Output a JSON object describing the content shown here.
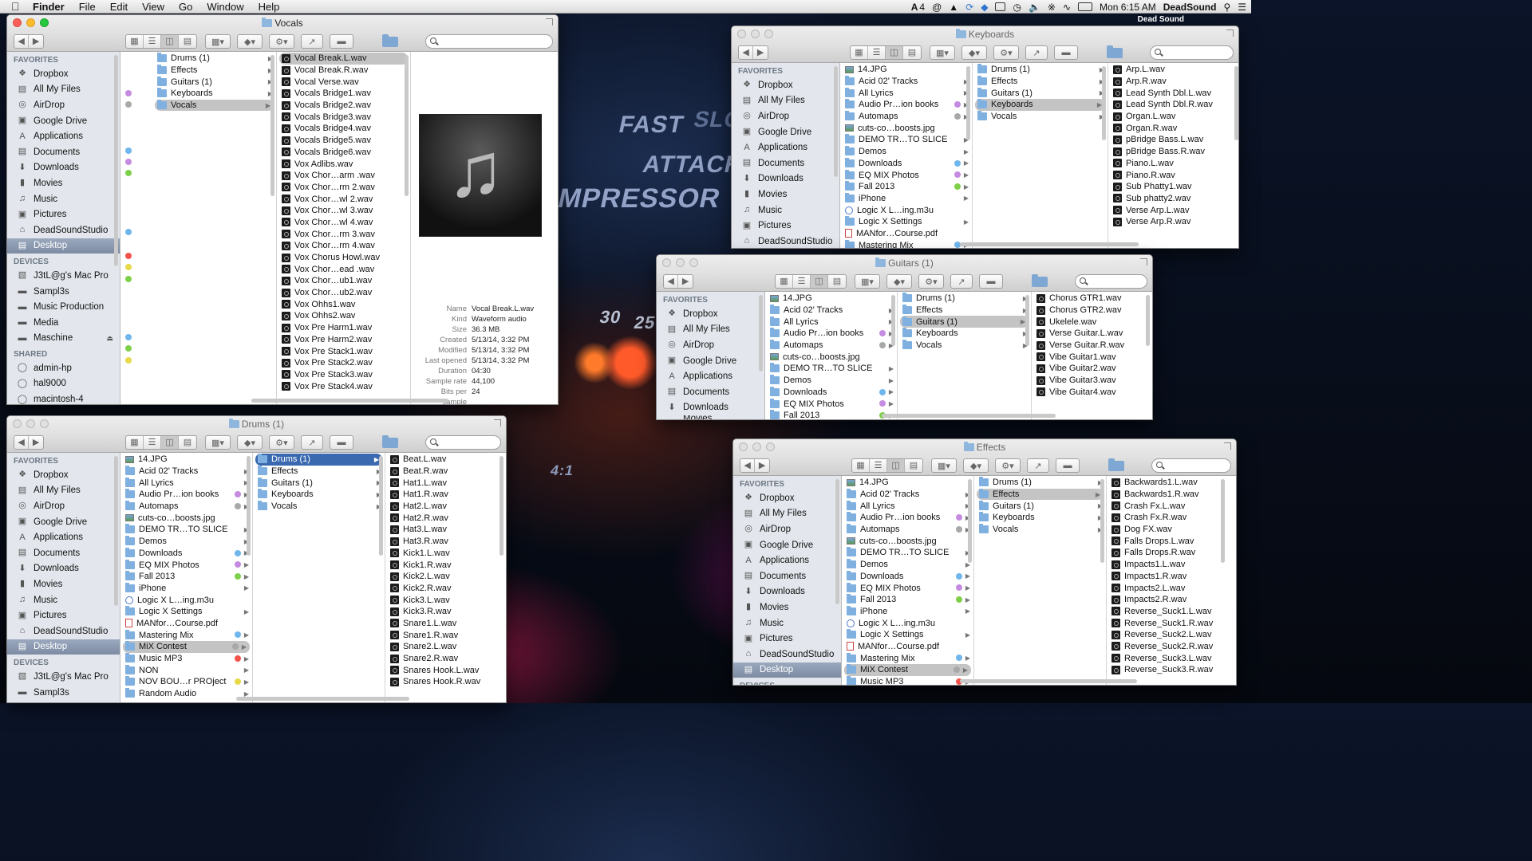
{
  "menubar": {
    "app": "Finder",
    "items": [
      "File",
      "Edit",
      "View",
      "Go",
      "Window",
      "Help"
    ],
    "right": {
      "adobe_count": "4",
      "clock": "Mon 6:15 AM",
      "user": "DeadSound"
    },
    "profile_badge": "Dead Sound"
  },
  "wallpaper": {
    "texts": [
      "FAST",
      "ATTACK",
      "MPRESSOR",
      "SLO",
      "30",
      "25",
      "4:1"
    ]
  },
  "colors": {
    "tag_red": "#f4524b",
    "tag_orange": "#f6a23b",
    "tag_yellow": "#e7d94a",
    "tag_green": "#7ed04b",
    "tag_blue": "#6fb6ec",
    "tag_purple": "#c58be0",
    "tag_gray": "#a8a8a8",
    "selection_blue": "#3a69b0"
  },
  "sidebar_common": {
    "favorites_header": "FAVORITES",
    "devices_header": "DEVICES",
    "shared_header": "SHARED",
    "favorites": [
      {
        "label": "Dropbox",
        "icon": "dropbox-icon"
      },
      {
        "label": "All My Files",
        "icon": "all-files-icon"
      },
      {
        "label": "AirDrop",
        "icon": "airdrop-icon"
      },
      {
        "label": "Google Drive",
        "icon": "folder-icon"
      },
      {
        "label": "Applications",
        "icon": "applications-icon"
      },
      {
        "label": "Documents",
        "icon": "documents-icon"
      },
      {
        "label": "Downloads",
        "icon": "downloads-icon"
      },
      {
        "label": "Movies",
        "icon": "movies-icon"
      },
      {
        "label": "Music",
        "icon": "music-icon"
      },
      {
        "label": "Pictures",
        "icon": "pictures-icon"
      },
      {
        "label": "DeadSoundStudio",
        "icon": "home-icon"
      },
      {
        "label": "Desktop",
        "icon": "desktop-icon"
      }
    ],
    "devices": [
      {
        "label": "J3tL@g's Mac Pro",
        "icon": "computer-icon"
      },
      {
        "label": "Sampl3s",
        "icon": "disk-icon"
      },
      {
        "label": "Music Production",
        "icon": "disk-icon"
      },
      {
        "label": "Media",
        "icon": "disk-icon"
      },
      {
        "label": "Maschine",
        "icon": "disk-icon"
      }
    ],
    "shared": [
      {
        "label": "admin-hp",
        "icon": "server-icon"
      },
      {
        "label": "hal9000",
        "icon": "server-icon"
      },
      {
        "label": "macintosh-4",
        "icon": "server-icon"
      }
    ],
    "movies_partial": "Movies"
  },
  "library_root": [
    "14.JPG",
    "Acid 02' Tracks",
    "All Lyrics",
    "Audio Pr…ion books",
    "Automaps",
    "cuts-co…boosts.jpg",
    "DEMO TR…TO SLICE",
    "Demos",
    "Downloads",
    "EQ MIX Photos",
    "Fall 2013",
    "iPhone",
    "Logic X L…ing.m3u",
    "Logic X Settings",
    "MANfor…Course.pdf",
    "Mastering Mix",
    "MiX Contest",
    "Music MP3",
    "NON",
    "NOV BOU…r PROject",
    "Random Audio"
  ],
  "sample_folders": [
    "Drums (1)",
    "Effects",
    "Guitars (1)",
    "Keyboards",
    "Vocals"
  ],
  "windows": {
    "vocals": {
      "title": "Vocals",
      "files": [
        "Vocal Break.L.wav",
        "Vocal Break.R.wav",
        "Vocal Verse.wav",
        "Vocals Bridge1.wav",
        "Vocals Bridge2.wav",
        "Vocals Bridge3.wav",
        "Vocals Bridge4.wav",
        "Vocals Bridge5.wav",
        "Vocals Bridge6.wav",
        "Vox Adlibs.wav",
        "Vox Chor…arm .wav",
        "Vox Chor…rm 2.wav",
        "Vox Chor…wl 2.wav",
        "Vox Chor…wl 3.wav",
        "Vox Chor…wl 4.wav",
        "Vox Chor…rm 3.wav",
        "Vox Chor…rm 4.wav",
        "Vox Chorus Howl.wav",
        "Vox Chor…ead .wav",
        "Vox Chor…ub1.wav",
        "Vox Chor…ub2.wav",
        "Vox Ohhs1.wav",
        "Vox Ohhs2.wav",
        "Vox Pre Harm1.wav",
        "Vox Pre Harm2.wav",
        "Vox Pre Stack1.wav",
        "Vox Pre Stack2.wav",
        "Vox Pre Stack3.wav",
        "Vox Pre Stack4.wav"
      ],
      "info": [
        {
          "k": "Name",
          "v": "Vocal Break.L.wav"
        },
        {
          "k": "Kind",
          "v": "Waveform audio"
        },
        {
          "k": "Size",
          "v": "36.3 MB"
        },
        {
          "k": "Created",
          "v": "5/13/14, 3:32 PM"
        },
        {
          "k": "Modified",
          "v": "5/13/14, 3:32 PM"
        },
        {
          "k": "Last opened",
          "v": "5/13/14, 3:32 PM"
        },
        {
          "k": "Duration",
          "v": "04:30"
        },
        {
          "k": "Sample rate",
          "v": "44,100"
        },
        {
          "k": "Bits per sample",
          "v": "24"
        }
      ]
    },
    "keyboards": {
      "title": "Keyboards",
      "files": [
        "Arp.L.wav",
        "Arp.R.wav",
        "Lead Synth Dbl.L.wav",
        "Lead Synth Dbl.R.wav",
        "Organ.L.wav",
        "Organ.R.wav",
        "pBridge Bass.L.wav",
        "pBridge Bass.R.wav",
        "Piano.L.wav",
        "Piano.R.wav",
        "Sub Phatty1.wav",
        "Sub phatty2.wav",
        "Verse Arp.L.wav",
        "Verse Arp.R.wav"
      ]
    },
    "guitars": {
      "title": "Guitars (1)",
      "files": [
        "Chorus GTR1.wav",
        "Chorus GTR2.wav",
        "Ukelele.wav",
        "Verse Guitar.L.wav",
        "Verse Guitar.R.wav",
        "Vibe Guitar1.wav",
        "Vibe Guitar2.wav",
        "Vibe Guitar3.wav",
        "Vibe Guitar4.wav"
      ]
    },
    "drums": {
      "title": "Drums (1)",
      "files": [
        "Beat.L.wav",
        "Beat.R.wav",
        "Hat1.L.wav",
        "Hat1.R.wav",
        "Hat2.L.wav",
        "Hat2.R.wav",
        "Hat3.L.wav",
        "Hat3.R.wav",
        "Kick1.L.wav",
        "Kick1.R.wav",
        "Kick2.L.wav",
        "Kick2.R.wav",
        "Kick3.L.wav",
        "Kick3.R.wav",
        "Snare1.L.wav",
        "Snare1.R.wav",
        "Snare2.L.wav",
        "Snare2.R.wav",
        "Snares Hook.L.wav",
        "Snares Hook.R.wav"
      ]
    },
    "effects": {
      "title": "Effects",
      "files": [
        "Backwards1.L.wav",
        "Backwards1.R.wav",
        "Crash Fx.L.wav",
        "Crash Fx.R.wav",
        "Dog FX.wav",
        "Falls Drops.L.wav",
        "Falls Drops.R.wav",
        "Impacts1.L.wav",
        "Impacts1.R.wav",
        "Impacts2.L.wav",
        "Impacts2.R.wav",
        "Reverse_Suck1.L.wav",
        "Reverse_Suck1.R.wav",
        "Reverse_Suck2.L.wav",
        "Reverse_Suck2.R.wav",
        "Reverse_Suck3.L.wav",
        "Reverse_Suck3.R.wav"
      ]
    }
  }
}
